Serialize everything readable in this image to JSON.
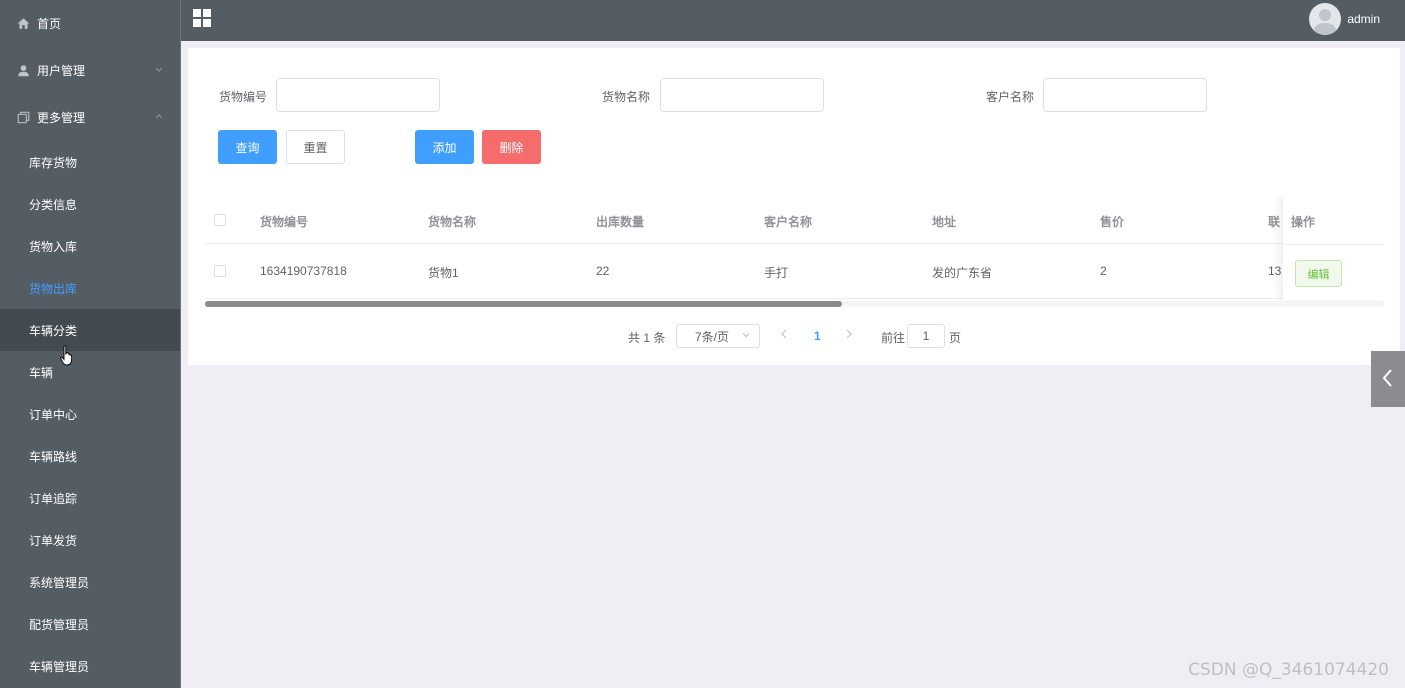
{
  "sidebar": {
    "home": {
      "label": "首页",
      "icon": "home-icon"
    },
    "user_mgmt": {
      "label": "用户管理",
      "icon": "user-icon"
    },
    "more_mgmt": {
      "label": "更多管理",
      "icon": "copy-icon"
    },
    "sub_items": [
      {
        "label": "库存货物"
      },
      {
        "label": "分类信息"
      },
      {
        "label": "货物入库"
      },
      {
        "label": "货物出库",
        "active": true
      },
      {
        "label": "车辆分类",
        "hover": true
      },
      {
        "label": "车辆"
      },
      {
        "label": "订单中心"
      },
      {
        "label": "车辆路线"
      },
      {
        "label": "订单追踪"
      },
      {
        "label": "订单发货"
      },
      {
        "label": "系统管理员"
      },
      {
        "label": "配货管理员"
      },
      {
        "label": "车辆管理员"
      }
    ]
  },
  "topbar": {
    "username": "admin"
  },
  "search": {
    "goods_no_label": "货物编号",
    "goods_no_value": "",
    "goods_name_label": "货物名称",
    "goods_name_value": "",
    "customer_label": "客户名称",
    "customer_value": ""
  },
  "actions": {
    "query": "查询",
    "reset": "重置",
    "add": "添加",
    "delete": "删除"
  },
  "table": {
    "columns": [
      "货物编号",
      "货物名称",
      "出库数量",
      "客户名称",
      "地址",
      "售价",
      "联系电话"
    ],
    "column_visible": [
      "货物编号",
      "货物名称",
      "出库数量",
      "客户名称",
      "地址",
      "售价",
      "联"
    ],
    "op_column": "操作",
    "rows": [
      {
        "goods_no": "1634190737818",
        "goods_name": "货物1",
        "quantity": "22",
        "customer": "手打",
        "address": "发的广东省",
        "price": "2",
        "phone": "13",
        "edit": "编辑"
      }
    ],
    "scroll_fraction": 0.54
  },
  "pagination": {
    "total": "共 1 条",
    "page_size": "7条/页",
    "current_page": "1",
    "goto_label": "前往",
    "goto_value": "1",
    "page_unit": "页"
  },
  "watermark": "CSDN @Q_3461074420",
  "colors": {
    "sidebar_bg": "#545c64",
    "primary": "#409eff",
    "danger": "#f56c6c",
    "success": "#67c23a"
  }
}
